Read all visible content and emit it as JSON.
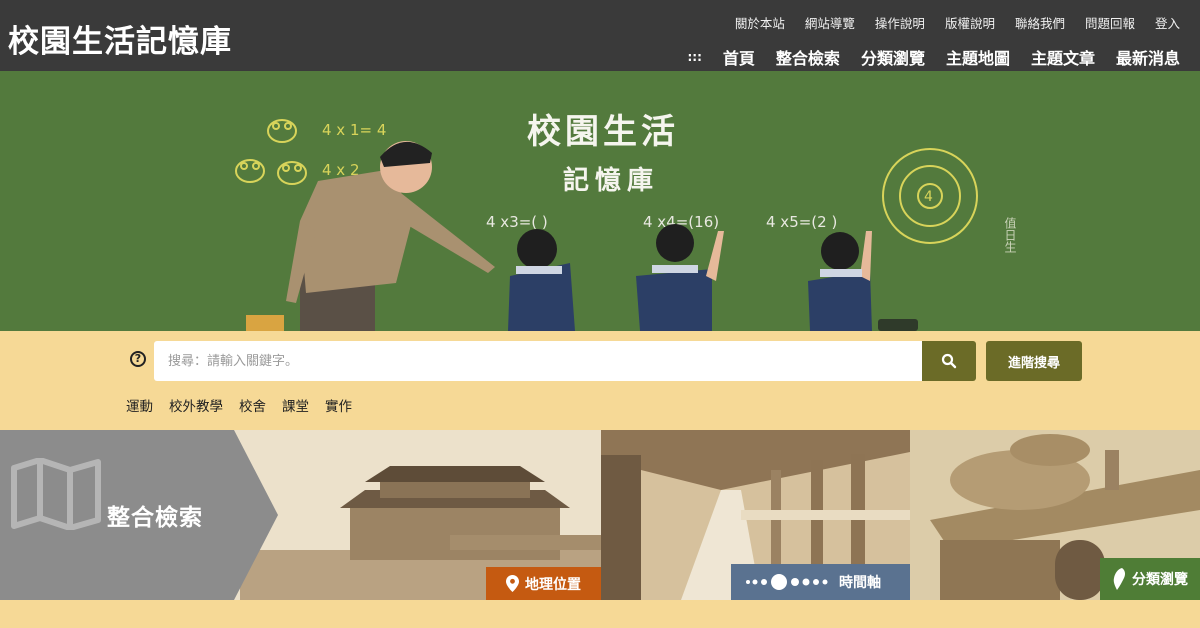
{
  "header": {
    "site_title": "校園生活記憶庫",
    "util_nav": [
      "關於本站",
      "網站導覽",
      "操作說明",
      "版權說明",
      "聯絡我們",
      "問題回報",
      "登入"
    ],
    "main_nav_dots": ":::",
    "main_nav": [
      "首頁",
      "整合檢索",
      "分類瀏覽",
      "主題地圖",
      "主題文章",
      "最新消息"
    ]
  },
  "hero": {
    "title_line1": "校園生活",
    "title_line2": "記憶庫",
    "chalk_eq1": "4 x 1= 4",
    "chalk_eq2": "4 x 2",
    "chalk_eq3": "4 x3=(    )",
    "chalk_eq4": "4 x4=(16)",
    "chalk_eq5": "4 x5=(2  )",
    "chalk_side": "值日生"
  },
  "search": {
    "help_symbol": "?",
    "placeholder": "搜尋：請輸入關鍵字。",
    "value": "",
    "advanced_label": "進階搜尋",
    "tags": [
      "運動",
      "校外教學",
      "校舍",
      "課堂",
      "實作"
    ]
  },
  "features": {
    "integrated_label": "整合檢索",
    "geo_label": "地理位置",
    "timeline_label": "時間軸",
    "category_label": "分類瀏覽"
  },
  "colors": {
    "header_bg": "#3a3a3a",
    "hero_green": "#537a3d",
    "band_yellow": "#f6d996",
    "button_olive": "#6b6b27",
    "geo_orange": "#c55a11",
    "time_blue": "#5a7290",
    "cat_green": "#4f7d36"
  }
}
